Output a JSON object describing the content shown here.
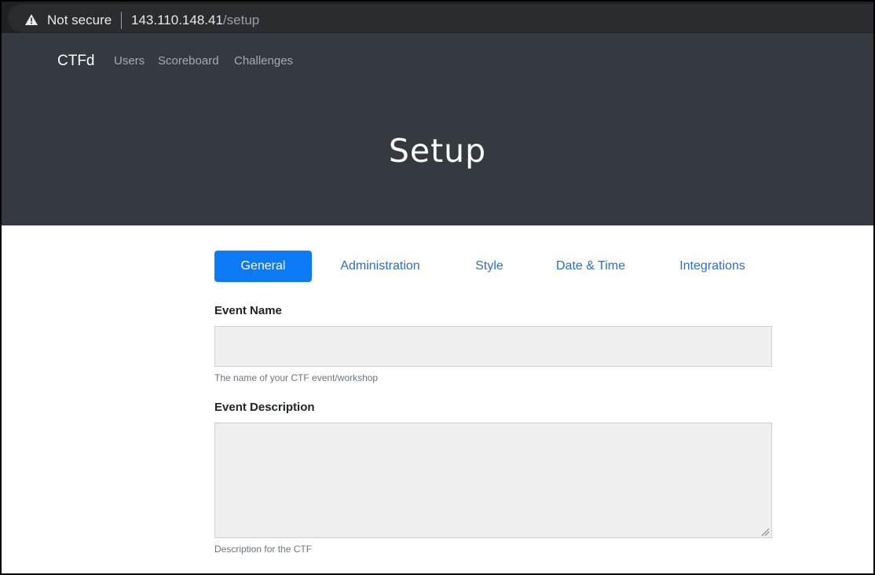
{
  "browser": {
    "security_label": "Not secure",
    "url_host": "143.110.148.41",
    "url_path": "/setup"
  },
  "nav": {
    "brand": "CTFd",
    "links": [
      "Users",
      "Scoreboard",
      "Challenges"
    ]
  },
  "page": {
    "title": "Setup"
  },
  "tabs": [
    {
      "label": "General",
      "active": true
    },
    {
      "label": "Administration",
      "active": false
    },
    {
      "label": "Style",
      "active": false
    },
    {
      "label": "Date & Time",
      "active": false
    },
    {
      "label": "Integrations",
      "active": false
    }
  ],
  "form": {
    "event_name": {
      "label": "Event Name",
      "value": "",
      "help": "The name of your CTF event/workshop"
    },
    "event_description": {
      "label": "Event Description",
      "value": "",
      "help": "Description for the CTF"
    }
  },
  "colors": {
    "header_bg": "#343a40",
    "accent": "#0d7bf5",
    "tab_link": "#2f6fb6",
    "input_bg": "#efefef"
  }
}
